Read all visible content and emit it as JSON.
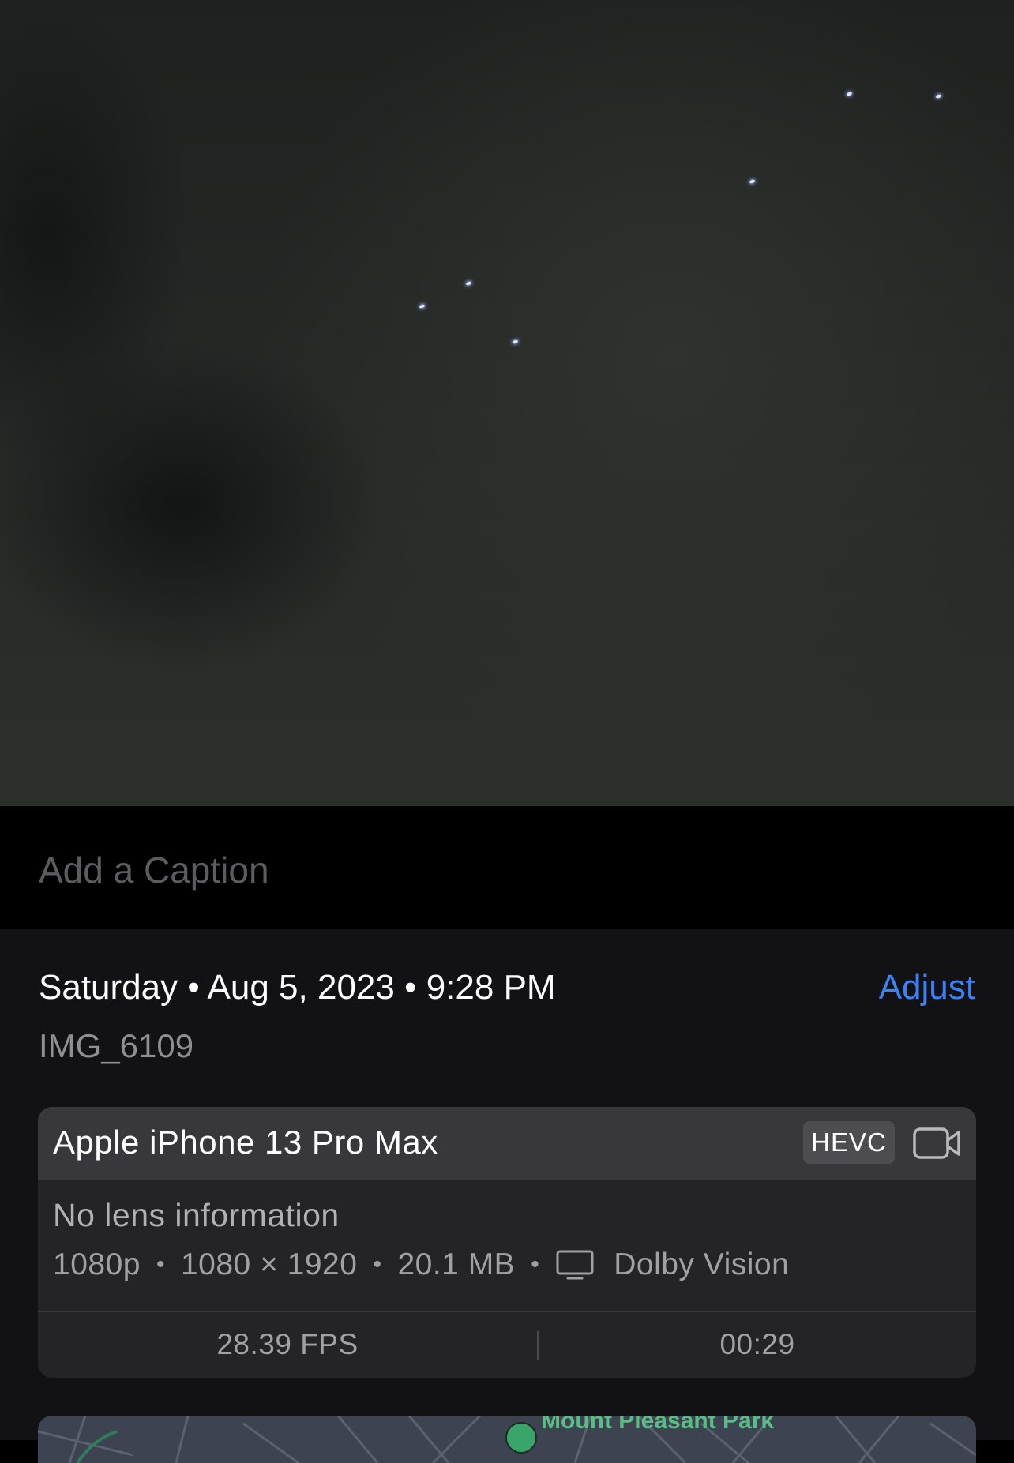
{
  "caption": {
    "placeholder": "Add a Caption",
    "value": ""
  },
  "details": {
    "date_line": "Saturday • Aug 5, 2023 • 9:28 PM",
    "adjust_label": "Adjust",
    "filename": "IMG_6109"
  },
  "card": {
    "device": "Apple iPhone 13 Pro Max",
    "codec": "HEVC",
    "camera_icon": "video-camera-icon",
    "lens": "No lens information",
    "resolution": "1080p",
    "dimensions": "1080 × 1920",
    "size": "20.1 MB",
    "display_icon": "display-icon",
    "hdr": "Dolby Vision",
    "fps": "28.39 FPS",
    "duration": "00:29"
  },
  "map": {
    "label": "Mount Pleasant Park"
  },
  "colors": {
    "accent": "#3b82f6",
    "panel": "#121215",
    "card": "#242428",
    "card_header": "#38383c"
  }
}
